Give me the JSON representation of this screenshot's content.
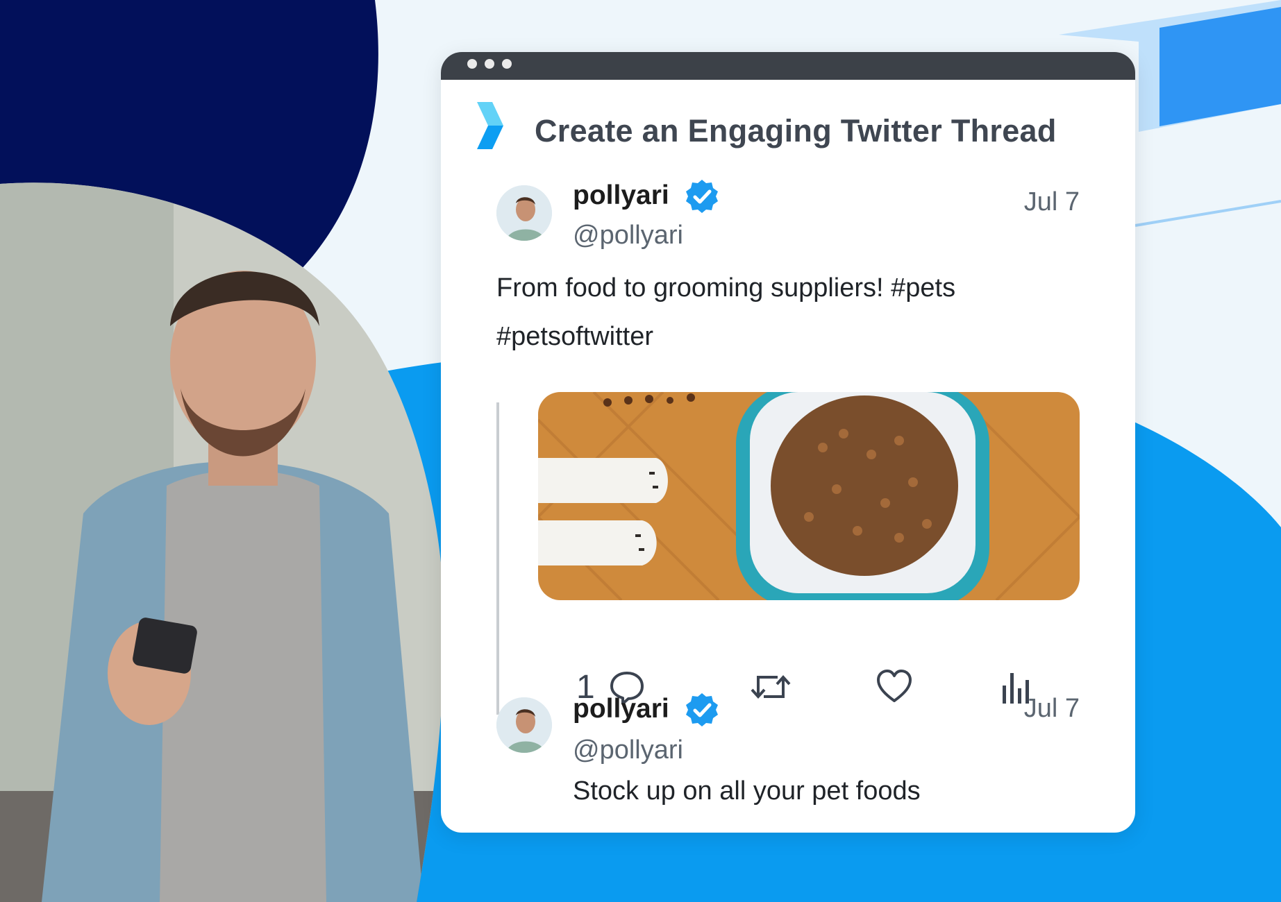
{
  "header": {
    "title": "Create an Engaging Twitter Thread"
  },
  "thread": [
    {
      "username": "pollyari",
      "handle": "@pollyari",
      "date": "Jul 7",
      "text_line1": "From food to grooming suppliers! #pets",
      "text_line2": "#petsoftwitter",
      "actions": {
        "reply_count": "1"
      }
    },
    {
      "username": "pollyari",
      "handle": "@pollyari",
      "date": "Jul 7",
      "text": "Stock up on all your pet foods"
    }
  ],
  "colors": {
    "navy": "#02105a",
    "brand_blue": "#0a9bf0",
    "verified": "#1d9bf0"
  },
  "icons": [
    "chevron-logo-icon",
    "verified-badge-icon",
    "reply-icon",
    "retweet-icon",
    "like-icon",
    "analytics-icon"
  ]
}
